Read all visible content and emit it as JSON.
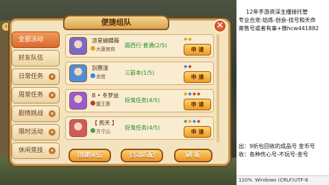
{
  "panel": {
    "title": "便捷组队",
    "close_glyph": "✕"
  },
  "sidebar": {
    "items": [
      {
        "label": "全部活动",
        "active": true,
        "has_chevron": false
      },
      {
        "label": "好友队伍",
        "active": false,
        "has_chevron": false
      },
      {
        "label": "日常任务",
        "active": false,
        "has_chevron": true
      },
      {
        "label": "周常任务",
        "active": false,
        "has_chevron": true
      },
      {
        "label": "剧情挑战",
        "active": false,
        "has_chevron": true
      },
      {
        "label": "限时活动",
        "active": false,
        "has_chevron": true
      },
      {
        "label": "休闲竞技",
        "active": false,
        "has_chevron": true
      }
    ]
  },
  "teams": [
    {
      "name": "凉星蝴蝶薇",
      "guild": "大唐官府",
      "task": "踢西行·普通(2/5)",
      "task_color": "#1f8f2a",
      "apply": "申 请",
      "avatar_color": "#7a6ac8"
    },
    {
      "name": "别赛湿",
      "guild": "龙宫",
      "task": "三箭本(1/5)",
      "task_color": "#1f8f2a",
      "apply": "申 请",
      "avatar_color": "#4f8fd8"
    },
    {
      "name": "B • 冬梦益",
      "guild": "魔王寨",
      "task": "捉鬼任务(4/5)",
      "task_color": "#1f8f2a",
      "apply": "申 请",
      "avatar_color": "#9a5ad0"
    },
    {
      "name": "【 荊天 】",
      "guild": "方寸山",
      "task": "捉鬼任务(4/5)",
      "task_color": "#1f8f2a",
      "apply": "申 请",
      "avatar_color": "#d05a5a"
    }
  ],
  "buttons": {
    "create": "创建队伍",
    "auto_match": "自动匹配",
    "refresh": "刷 新"
  },
  "notepad": {
    "line1": "12年手游资深主播接托管",
    "line2": "专业合宠-焰炼-创会-找号和天命",
    "line3": "寄售号或者有事+微hcw441882",
    "line4": "出：9折包回收的成品号  金币号",
    "line5": "收：各种伤心号-不玩号-金号"
  },
  "statusbar": {
    "zoom": "110%",
    "eol": "Windows (CRLF)",
    "encoding": "UTF-8"
  }
}
